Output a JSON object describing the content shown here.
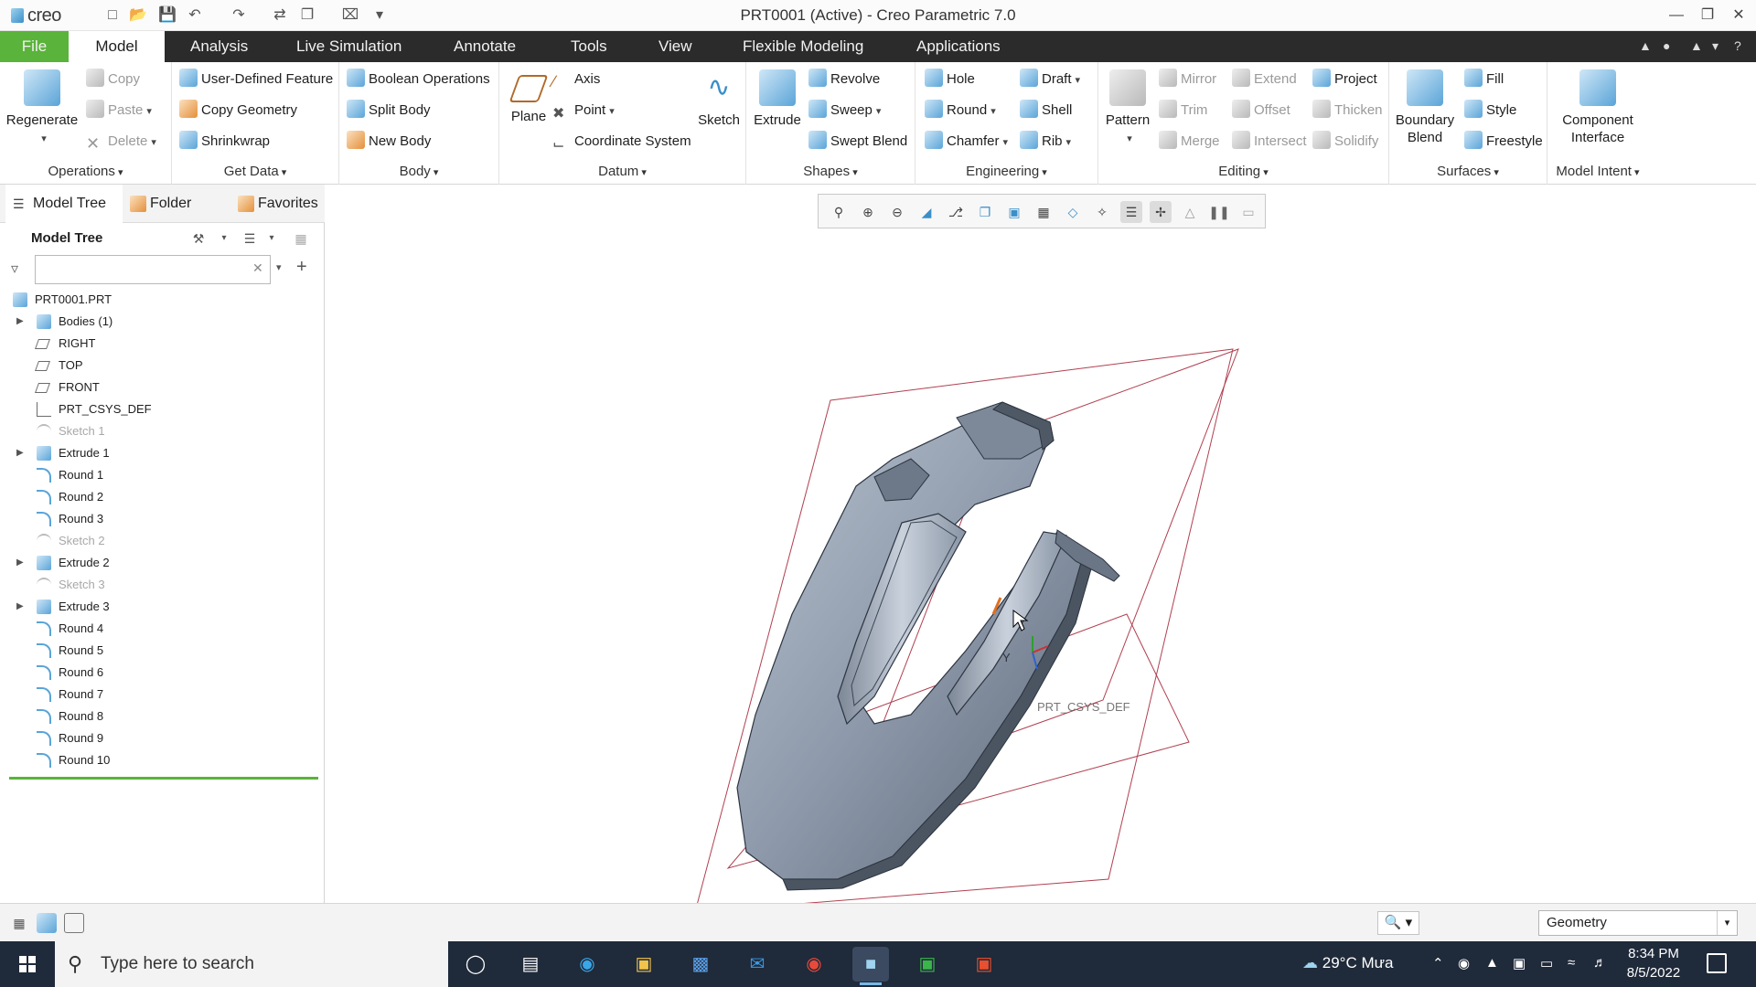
{
  "window": {
    "title": "PRT0001 (Active) - Creo Parametric 7.0",
    "app_name": "creo",
    "controls": [
      "minimize",
      "restore",
      "close"
    ]
  },
  "quick_access": [
    "new-icon",
    "open-icon",
    "save-icon",
    "undo-icon",
    "redo-icon",
    "regenerate-icon",
    "windows-icon",
    "close-window-icon",
    "customize-icon"
  ],
  "menu": {
    "tabs": [
      "File",
      "Model",
      "Analysis",
      "Live Simulation",
      "Annotate",
      "Tools",
      "View",
      "Flexible Modeling",
      "Applications"
    ],
    "active": "Model"
  },
  "ribbon": {
    "operations": {
      "label": "Operations",
      "regenerate": "Regenerate",
      "copy": "Copy",
      "paste": "Paste",
      "delete": "Delete"
    },
    "get_data": {
      "label": "Get Data",
      "items": [
        "User-Defined Feature",
        "Copy Geometry",
        "Shrinkwrap"
      ]
    },
    "body": {
      "label": "Body",
      "items": [
        "Boolean Operations",
        "Split Body",
        "New Body"
      ]
    },
    "datum": {
      "label": "Datum",
      "plane": "Plane",
      "axis": "Axis",
      "point": "Point",
      "csys": "Coordinate System",
      "sketch": "Sketch"
    },
    "shapes": {
      "label": "Shapes",
      "extrude": "Extrude",
      "revolve": "Revolve",
      "sweep": "Sweep",
      "swept_blend": "Swept Blend"
    },
    "engineering": {
      "label": "Engineering",
      "hole": "Hole",
      "round": "Round",
      "chamfer": "Chamfer",
      "draft": "Draft",
      "shell": "Shell",
      "rib": "Rib"
    },
    "editing": {
      "label": "Editing",
      "pattern": "Pattern",
      "mirror": "Mirror",
      "trim": "Trim",
      "merge": "Merge",
      "extend": "Extend",
      "offset": "Offset",
      "intersect": "Intersect",
      "project": "Project",
      "thicken": "Thicken",
      "solidify": "Solidify"
    },
    "surfaces": {
      "label": "Surfaces",
      "boundary_blend_1": "Boundary",
      "boundary_blend_2": "Blend",
      "fill": "Fill",
      "style": "Style",
      "freestyle": "Freestyle"
    },
    "model_intent": {
      "label": "Model Intent",
      "component_interface_1": "Component",
      "component_interface_2": "Interface"
    }
  },
  "left_panel": {
    "tabs": [
      "Model Tree",
      "Folder Brov",
      "Favorites"
    ],
    "header": "Model Tree",
    "search_placeholder": "",
    "tree": [
      {
        "label": "PRT0001.PRT",
        "icon": "part-icon",
        "expandable": false,
        "dim": false,
        "indent": 0
      },
      {
        "label": "Bodies (1)",
        "icon": "bodies-icon",
        "expandable": true,
        "dim": false,
        "indent": 1
      },
      {
        "label": "RIGHT",
        "icon": "datum-plane-icon",
        "expandable": false,
        "dim": false,
        "indent": 1
      },
      {
        "label": "TOP",
        "icon": "datum-plane-icon",
        "expandable": false,
        "dim": false,
        "indent": 1
      },
      {
        "label": "FRONT",
        "icon": "datum-plane-icon",
        "expandable": false,
        "dim": false,
        "indent": 1
      },
      {
        "label": "PRT_CSYS_DEF",
        "icon": "csys-icon",
        "expandable": false,
        "dim": false,
        "indent": 1
      },
      {
        "label": "Sketch 1",
        "icon": "sketch-icon",
        "expandable": false,
        "dim": true,
        "indent": 1
      },
      {
        "label": "Extrude 1",
        "icon": "extrude-icon",
        "expandable": true,
        "dim": false,
        "indent": 1
      },
      {
        "label": "Round 1",
        "icon": "round-icon",
        "expandable": false,
        "dim": false,
        "indent": 1
      },
      {
        "label": "Round 2",
        "icon": "round-icon",
        "expandable": false,
        "dim": false,
        "indent": 1
      },
      {
        "label": "Round 3",
        "icon": "round-icon",
        "expandable": false,
        "dim": false,
        "indent": 1
      },
      {
        "label": "Sketch 2",
        "icon": "sketch-icon",
        "expandable": false,
        "dim": true,
        "indent": 1
      },
      {
        "label": "Extrude 2",
        "icon": "extrude-icon",
        "expandable": true,
        "dim": false,
        "indent": 1
      },
      {
        "label": "Sketch 3",
        "icon": "sketch-icon",
        "expandable": false,
        "dim": true,
        "indent": 1
      },
      {
        "label": "Extrude 3",
        "icon": "extrude-icon",
        "expandable": true,
        "dim": false,
        "indent": 1
      },
      {
        "label": "Round 4",
        "icon": "round-icon",
        "expandable": false,
        "dim": false,
        "indent": 1
      },
      {
        "label": "Round 5",
        "icon": "round-icon",
        "expandable": false,
        "dim": false,
        "indent": 1
      },
      {
        "label": "Round 6",
        "icon": "round-icon",
        "expandable": false,
        "dim": false,
        "indent": 1
      },
      {
        "label": "Round 7",
        "icon": "round-icon",
        "expandable": false,
        "dim": false,
        "indent": 1
      },
      {
        "label": "Round 8",
        "icon": "round-icon",
        "expandable": false,
        "dim": false,
        "indent": 1
      },
      {
        "label": "Round 9",
        "icon": "round-icon",
        "expandable": false,
        "dim": false,
        "indent": 1
      },
      {
        "label": "Round 10",
        "icon": "round-icon",
        "expandable": false,
        "dim": false,
        "indent": 1
      }
    ]
  },
  "graphics": {
    "csys_label": "PRT_CSYS_DEF",
    "axis_label": "Y",
    "view_toolbar": [
      "refit-icon",
      "zoom-in-icon",
      "zoom-out-icon",
      "repaint-icon",
      "reorient-icon",
      "saved-orientations-icon",
      "display-style-icon",
      "section-icon",
      "perspective-icon",
      "datum-display-icon",
      "annotation-display-icon",
      "spin-center-icon",
      "datum-filter-icon",
      "pause-icon",
      "stop-icon"
    ]
  },
  "status_bar": {
    "filter_value": "Geometry"
  },
  "taskbar": {
    "search_placeholder": "Type here to search",
    "apps": [
      "cortana-icon",
      "task-view-icon",
      "edge-icon",
      "file-explorer-icon",
      "store-icon",
      "mail-icon",
      "chrome-icon",
      "creo-icon",
      "camtasia-icon",
      "camtasia-recorder-icon"
    ],
    "weather": "29°C  Mưa",
    "time": "8:34 PM",
    "date": "8/5/2022"
  },
  "colors": {
    "file_tab": "#5ab33a",
    "menu_bar": "#2b2b2b",
    "model_surface": "#8e9aab",
    "datum_plane": "#b04050",
    "taskbar": "#1f2a3a"
  }
}
